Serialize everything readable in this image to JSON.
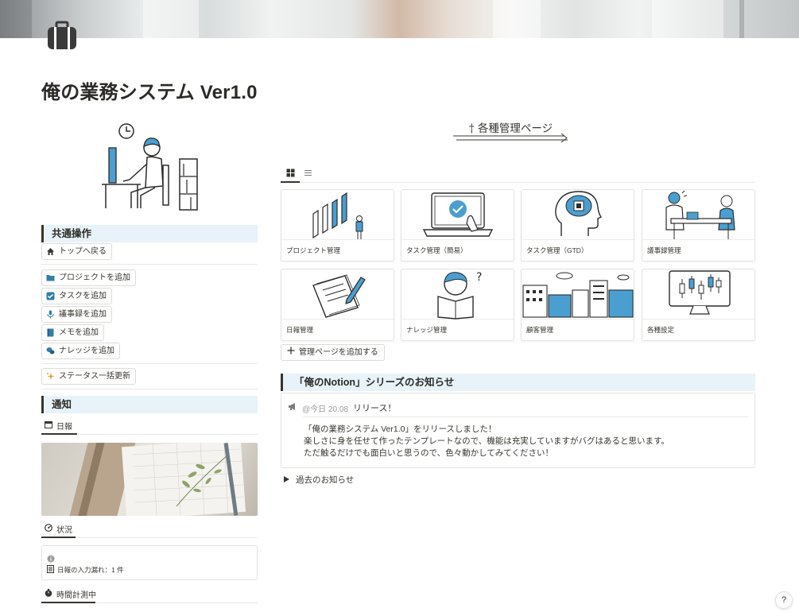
{
  "page": {
    "title": "俺の業務システム Ver1.0"
  },
  "common": {
    "header": "共通操作",
    "top_button": "トップへ戻る",
    "add_buttons": [
      "プロジェクトを追加",
      "タスクを追加",
      "議事録を追加",
      "メモを追加",
      "ナレッジを追加"
    ],
    "status_update": "ステータス一括更新"
  },
  "notification": {
    "header": "通知",
    "tab_daily": "日報",
    "tab_status": "状況",
    "missing_daily": "日報の入力漏れ：1 件",
    "tab_timer": "時間計測中"
  },
  "management": {
    "title": "† 各種管理ページ",
    "cards": [
      {
        "label": "プロジェクト管理",
        "icon": "project-chart-icon"
      },
      {
        "label": "タスク管理（簡易）",
        "icon": "laptop-check-icon"
      },
      {
        "label": "タスク管理（GTD）",
        "icon": "brain-chip-icon"
      },
      {
        "label": "議事録管理",
        "icon": "meeting-icon"
      },
      {
        "label": "日報管理",
        "icon": "notepad-pen-icon"
      },
      {
        "label": "ナレッジ管理",
        "icon": "reading-book-icon"
      },
      {
        "label": "顧客管理",
        "icon": "city-buildings-icon"
      },
      {
        "label": "各種設定",
        "icon": "monitor-candlestick-icon"
      }
    ],
    "add_page": "管理ページを追加する"
  },
  "news": {
    "header": "「俺のNotion」シリーズのお知らせ",
    "date": "@今日 20:08",
    "item_title": "リリース！",
    "body": [
      "「俺の業務システム Ver1.0」をリリースしました！",
      "楽しさに身を任せて作ったテンプレートなので、機能は充実していますがバグはあると思います。",
      "ただ触るだけでも面白いと思うので、色々動かしてみてください！"
    ],
    "past": "過去のお知らせ"
  },
  "help": "?",
  "colors": {
    "accent": "#4a9fd0",
    "callout_bg": "#e7f3f8",
    "text": "#37352f"
  }
}
